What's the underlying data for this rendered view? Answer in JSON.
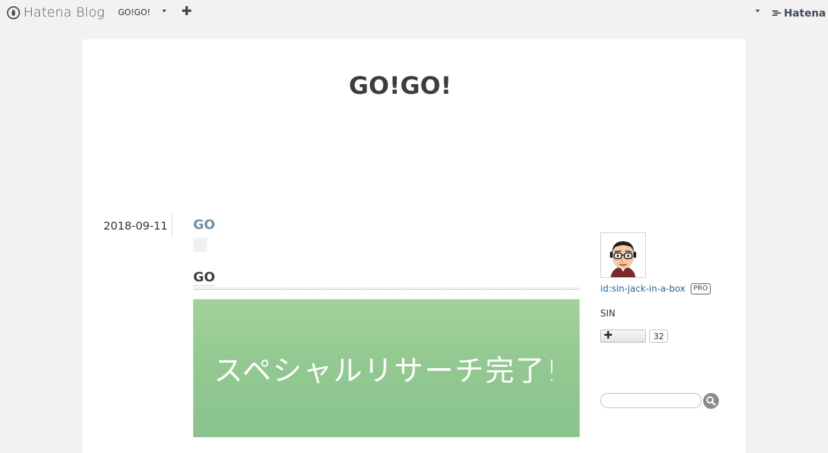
{
  "global_header": {
    "logo_text": "Hatena Blog",
    "blog_name": "GO!GO!",
    "brand_text": "Hatena",
    "icons": [
      "hatena-blog-logo-icon",
      "caret-down-icon",
      "plus-icon",
      "hatena-brand-icon"
    ]
  },
  "blog": {
    "title": "GO!GO!"
  },
  "entry": {
    "date": "2018-09-11",
    "title": "GO",
    "heading": "GO",
    "image_text": "スペシャルリサーチ完了!"
  },
  "sidebar": {
    "user_id": "id:sin-jack-in-a-box",
    "pro_badge": "PRO",
    "description": "SIN",
    "follow_count": "32",
    "icons": [
      "avatar",
      "plus-icon",
      "search-icon"
    ]
  },
  "colors": {
    "background": "#f2f2f2",
    "entry_title": "#6c8ea7",
    "link": "#2a6496",
    "image_green": "#93c991"
  }
}
